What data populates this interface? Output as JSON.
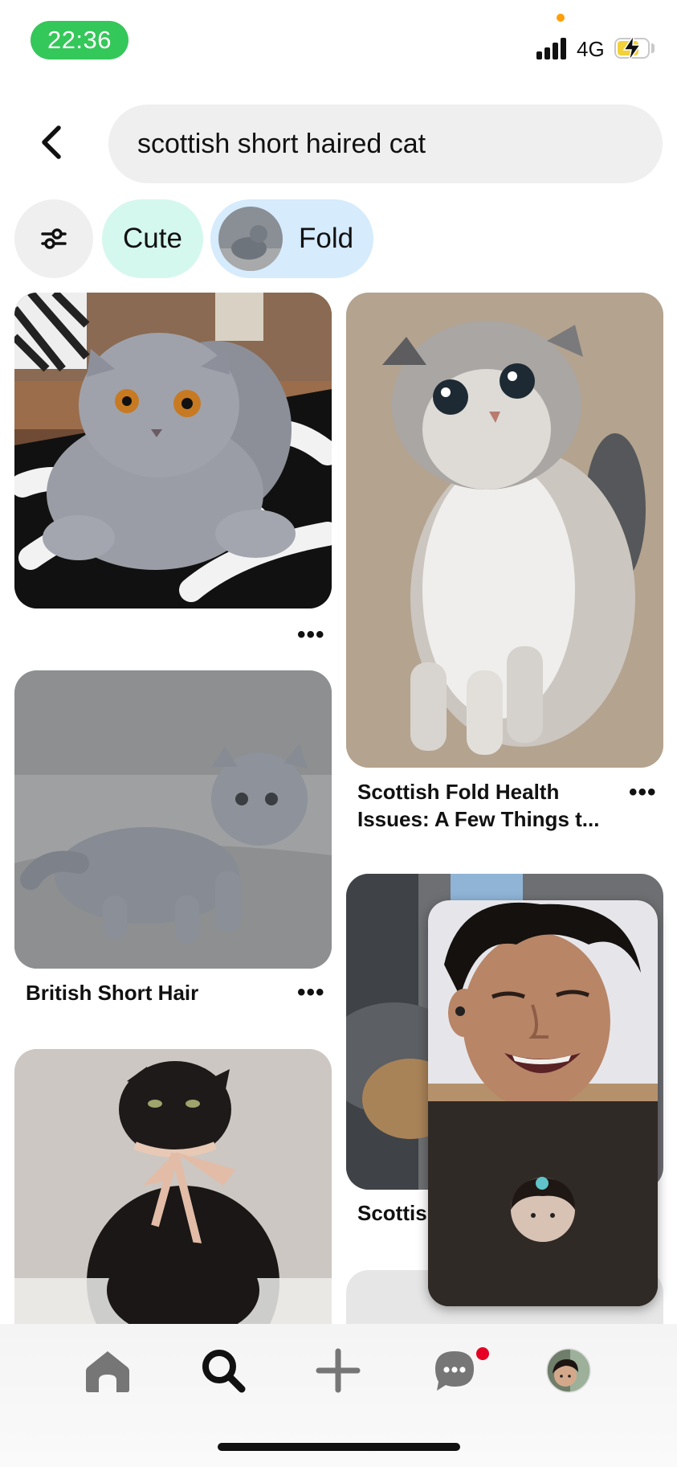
{
  "status_bar": {
    "time": "22:36",
    "network": "4G",
    "accent_green": "#34c759",
    "battery_color": "#f2d13a"
  },
  "search": {
    "query": "scottish short haired cat"
  },
  "chips": [
    {
      "label": "Cute",
      "color": "#d5f8ee"
    },
    {
      "label": "Fold",
      "color": "#d6ebfc"
    }
  ],
  "pins": [
    {
      "caption": "",
      "more": "•••"
    },
    {
      "caption_line1": "Scottish Fold Health",
      "caption_line2": "Issues: A Few Things t...",
      "more": "•••"
    },
    {
      "caption": "British Short Hair",
      "more": "•••"
    },
    {
      "caption": "Scottis"
    },
    {
      "caption": ""
    }
  ],
  "bottom_nav": {
    "items": [
      "home-icon",
      "search-icon",
      "plus-icon",
      "chat-icon",
      "profile-avatar"
    ],
    "active": "search-icon",
    "notification_color": "#e60023"
  }
}
